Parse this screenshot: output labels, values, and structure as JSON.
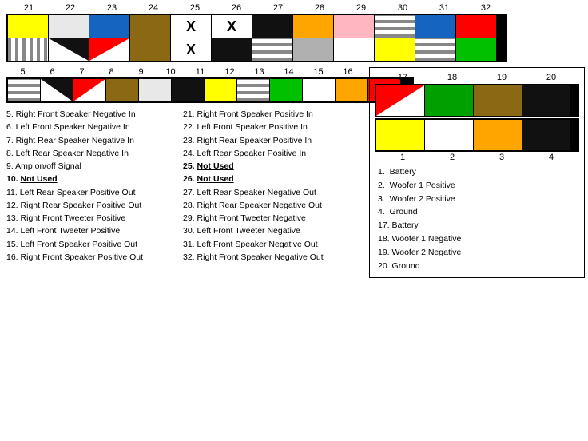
{
  "top_pins": {
    "labels": [
      "21",
      "22",
      "23",
      "24",
      "25",
      "26",
      "27",
      "28",
      "29",
      "30",
      "31",
      "32"
    ],
    "row1_colors": [
      "yellow",
      "#e8e8e8",
      "blue",
      "brown",
      "white",
      "white",
      "black",
      "orange",
      "pink",
      "striped",
      "blue",
      "red"
    ],
    "row2_colors": [
      "striped_v",
      "black",
      "red_tri",
      "brown",
      "white_x",
      "black",
      "striped_h",
      "gray",
      "white",
      "yellow",
      "striped",
      "green"
    ]
  },
  "mid_pins": {
    "labels": [
      "5",
      "6",
      "7",
      "8",
      "9",
      "10",
      "11",
      "12",
      "13",
      "14",
      "15",
      "16"
    ]
  },
  "left_labels": {
    "col1": [
      {
        "num": "5.",
        "text": "Right Front Speaker Negative In"
      },
      {
        "num": "6.",
        "text": "Left Front Speaker Negative In"
      },
      {
        "num": "7.",
        "text": "Right Rear Speaker Negative In"
      },
      {
        "num": "8.",
        "text": "Left Rear Speaker Negative In"
      },
      {
        "num": "9.",
        "text": "Amp on/off Signal"
      },
      {
        "num": "10.",
        "text": "Not Used",
        "bold": true
      },
      {
        "num": "11.",
        "text": "Left Rear Speaker Positive Out"
      },
      {
        "num": "12.",
        "text": "Right Rear Speaker Positive Out"
      },
      {
        "num": "13.",
        "text": "Right Front Tweeter Positive"
      },
      {
        "num": "14.",
        "text": "Left Front Tweeter Positive"
      },
      {
        "num": "15.",
        "text": "Left Front Speaker Positive Out"
      },
      {
        "num": "16.",
        "text": "Right Front Speaker Positive Out"
      }
    ],
    "col2": [
      {
        "num": "21.",
        "text": "Right Front Speaker Positive In"
      },
      {
        "num": "22.",
        "text": "Left Front Speaker Positive In"
      },
      {
        "num": "23.",
        "text": "Right Rear Speaker Positive In"
      },
      {
        "num": "24.",
        "text": "Left Rear Speaker Positive In"
      },
      {
        "num": "25.",
        "text": "Not Used",
        "bold": true
      },
      {
        "num": "26.",
        "text": "Not Used",
        "bold": true
      },
      {
        "num": "27.",
        "text": "Left Rear Speaker Negative Out"
      },
      {
        "num": "28.",
        "text": "Right Rear Speaker Negative Out"
      },
      {
        "num": "29.",
        "text": "Right Front Tweeter Negative"
      },
      {
        "num": "30.",
        "text": "Left Front Tweeter Negative"
      },
      {
        "num": "31.",
        "text": "Left Front Speaker Negative Out"
      },
      {
        "num": "32.",
        "text": "Right Front Speaker Negative Out"
      }
    ]
  },
  "right_panel": {
    "top_labels": [
      "17",
      "18",
      "19",
      "20"
    ],
    "bottom_labels": [
      "1",
      "2",
      "3",
      "4"
    ],
    "list": [
      {
        "num": "1.",
        "text": "Battery"
      },
      {
        "num": "2.",
        "text": "Woofer 1 Positive"
      },
      {
        "num": "3.",
        "text": "Woofer 2 Positive"
      },
      {
        "num": "4.",
        "text": "Ground"
      },
      {
        "num": "17.",
        "text": "Battery"
      },
      {
        "num": "18.",
        "text": "Woofer 1 Negative"
      },
      {
        "num": "19.",
        "text": "Woofer 2 Negative"
      },
      {
        "num": "20.",
        "text": "Ground"
      }
    ],
    "top_row_colors": [
      "red_black_tri",
      "green",
      "brown",
      "black"
    ],
    "bottom_row_colors": [
      "yellow",
      "white",
      "orange",
      "black"
    ]
  }
}
